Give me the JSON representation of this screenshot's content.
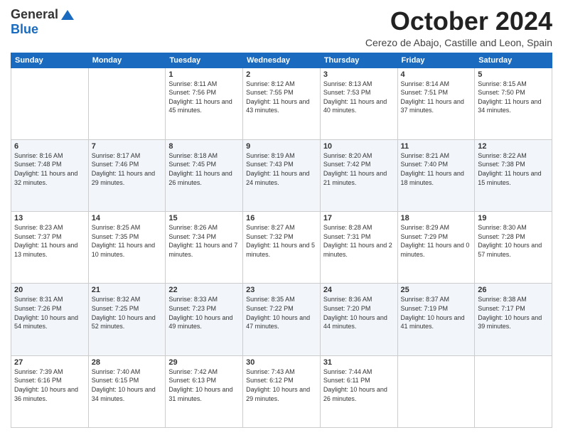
{
  "header": {
    "logo_line1": "General",
    "logo_line2": "Blue",
    "month": "October 2024",
    "location": "Cerezo de Abajo, Castille and Leon, Spain"
  },
  "days_of_week": [
    "Sunday",
    "Monday",
    "Tuesday",
    "Wednesday",
    "Thursday",
    "Friday",
    "Saturday"
  ],
  "weeks": [
    [
      {
        "day": "",
        "info": ""
      },
      {
        "day": "",
        "info": ""
      },
      {
        "day": "1",
        "info": "Sunrise: 8:11 AM\nSunset: 7:56 PM\nDaylight: 11 hours and 45 minutes."
      },
      {
        "day": "2",
        "info": "Sunrise: 8:12 AM\nSunset: 7:55 PM\nDaylight: 11 hours and 43 minutes."
      },
      {
        "day": "3",
        "info": "Sunrise: 8:13 AM\nSunset: 7:53 PM\nDaylight: 11 hours and 40 minutes."
      },
      {
        "day": "4",
        "info": "Sunrise: 8:14 AM\nSunset: 7:51 PM\nDaylight: 11 hours and 37 minutes."
      },
      {
        "day": "5",
        "info": "Sunrise: 8:15 AM\nSunset: 7:50 PM\nDaylight: 11 hours and 34 minutes."
      }
    ],
    [
      {
        "day": "6",
        "info": "Sunrise: 8:16 AM\nSunset: 7:48 PM\nDaylight: 11 hours and 32 minutes."
      },
      {
        "day": "7",
        "info": "Sunrise: 8:17 AM\nSunset: 7:46 PM\nDaylight: 11 hours and 29 minutes."
      },
      {
        "day": "8",
        "info": "Sunrise: 8:18 AM\nSunset: 7:45 PM\nDaylight: 11 hours and 26 minutes."
      },
      {
        "day": "9",
        "info": "Sunrise: 8:19 AM\nSunset: 7:43 PM\nDaylight: 11 hours and 24 minutes."
      },
      {
        "day": "10",
        "info": "Sunrise: 8:20 AM\nSunset: 7:42 PM\nDaylight: 11 hours and 21 minutes."
      },
      {
        "day": "11",
        "info": "Sunrise: 8:21 AM\nSunset: 7:40 PM\nDaylight: 11 hours and 18 minutes."
      },
      {
        "day": "12",
        "info": "Sunrise: 8:22 AM\nSunset: 7:38 PM\nDaylight: 11 hours and 15 minutes."
      }
    ],
    [
      {
        "day": "13",
        "info": "Sunrise: 8:23 AM\nSunset: 7:37 PM\nDaylight: 11 hours and 13 minutes."
      },
      {
        "day": "14",
        "info": "Sunrise: 8:25 AM\nSunset: 7:35 PM\nDaylight: 11 hours and 10 minutes."
      },
      {
        "day": "15",
        "info": "Sunrise: 8:26 AM\nSunset: 7:34 PM\nDaylight: 11 hours and 7 minutes."
      },
      {
        "day": "16",
        "info": "Sunrise: 8:27 AM\nSunset: 7:32 PM\nDaylight: 11 hours and 5 minutes."
      },
      {
        "day": "17",
        "info": "Sunrise: 8:28 AM\nSunset: 7:31 PM\nDaylight: 11 hours and 2 minutes."
      },
      {
        "day": "18",
        "info": "Sunrise: 8:29 AM\nSunset: 7:29 PM\nDaylight: 11 hours and 0 minutes."
      },
      {
        "day": "19",
        "info": "Sunrise: 8:30 AM\nSunset: 7:28 PM\nDaylight: 10 hours and 57 minutes."
      }
    ],
    [
      {
        "day": "20",
        "info": "Sunrise: 8:31 AM\nSunset: 7:26 PM\nDaylight: 10 hours and 54 minutes."
      },
      {
        "day": "21",
        "info": "Sunrise: 8:32 AM\nSunset: 7:25 PM\nDaylight: 10 hours and 52 minutes."
      },
      {
        "day": "22",
        "info": "Sunrise: 8:33 AM\nSunset: 7:23 PM\nDaylight: 10 hours and 49 minutes."
      },
      {
        "day": "23",
        "info": "Sunrise: 8:35 AM\nSunset: 7:22 PM\nDaylight: 10 hours and 47 minutes."
      },
      {
        "day": "24",
        "info": "Sunrise: 8:36 AM\nSunset: 7:20 PM\nDaylight: 10 hours and 44 minutes."
      },
      {
        "day": "25",
        "info": "Sunrise: 8:37 AM\nSunset: 7:19 PM\nDaylight: 10 hours and 41 minutes."
      },
      {
        "day": "26",
        "info": "Sunrise: 8:38 AM\nSunset: 7:17 PM\nDaylight: 10 hours and 39 minutes."
      }
    ],
    [
      {
        "day": "27",
        "info": "Sunrise: 7:39 AM\nSunset: 6:16 PM\nDaylight: 10 hours and 36 minutes."
      },
      {
        "day": "28",
        "info": "Sunrise: 7:40 AM\nSunset: 6:15 PM\nDaylight: 10 hours and 34 minutes."
      },
      {
        "day": "29",
        "info": "Sunrise: 7:42 AM\nSunset: 6:13 PM\nDaylight: 10 hours and 31 minutes."
      },
      {
        "day": "30",
        "info": "Sunrise: 7:43 AM\nSunset: 6:12 PM\nDaylight: 10 hours and 29 minutes."
      },
      {
        "day": "31",
        "info": "Sunrise: 7:44 AM\nSunset: 6:11 PM\nDaylight: 10 hours and 26 minutes."
      },
      {
        "day": "",
        "info": ""
      },
      {
        "day": "",
        "info": ""
      }
    ]
  ]
}
